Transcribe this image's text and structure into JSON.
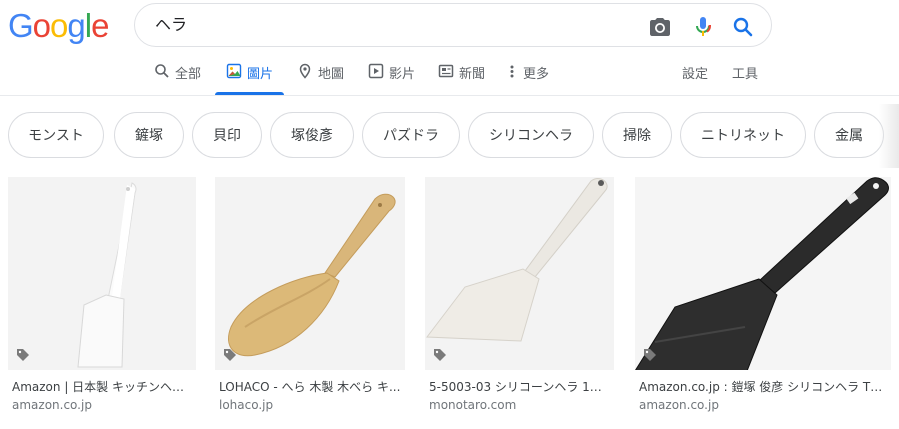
{
  "logo": {
    "letters": [
      "G",
      "o",
      "o",
      "g",
      "l",
      "e"
    ],
    "colors": [
      "#4285f4",
      "#ea4335",
      "#fbbc05",
      "#4285f4",
      "#34a853",
      "#ea4335"
    ]
  },
  "search": {
    "query": "ヘラ"
  },
  "icons": {
    "camera": "camera-icon",
    "mic": "microphone-icon",
    "search": "search-icon"
  },
  "nav": {
    "tabs": [
      {
        "label": "全部",
        "icon": "search-icon"
      },
      {
        "label": "圖片",
        "icon": "image-icon",
        "active": true
      },
      {
        "label": "地圖",
        "icon": "map-pin-icon"
      },
      {
        "label": "影片",
        "icon": "video-icon"
      },
      {
        "label": "新聞",
        "icon": "news-icon"
      },
      {
        "label": "更多",
        "icon": "more-vert-icon"
      }
    ],
    "settings": "設定",
    "tools": "工具"
  },
  "chips": [
    "モンスト",
    "鏟塚",
    "貝印",
    "塚俊彥",
    "パズドラ",
    "シリコンヘラ",
    "掃除",
    "ニトリネット",
    "金属"
  ],
  "results": [
    {
      "title": "Amazon | 日本製 キッチンヘラ ...",
      "source": "amazon.co.jp"
    },
    {
      "title": "LOHACO - へら 木製 木べら キ...",
      "source": "lohaco.jp"
    },
    {
      "title": "5-5003-03 シリコーンヘラ 1個 ...",
      "source": "monotaro.com"
    },
    {
      "title": "Amazon.co.jp : 鎧塚 俊彦 シリコンヘラ TY-...",
      "source": "amazon.co.jp"
    }
  ],
  "colors": {
    "accent": "#1a73e8",
    "text": "#202124",
    "muted": "#70757a"
  }
}
